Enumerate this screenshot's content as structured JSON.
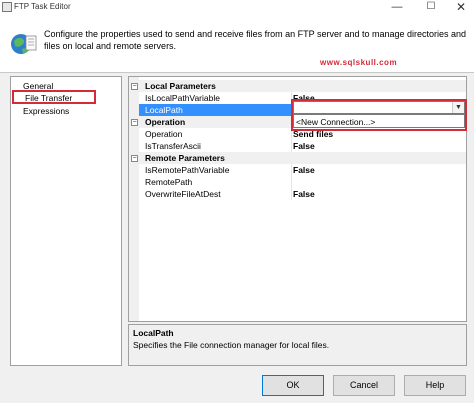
{
  "window": {
    "title": "FTP Task Editor",
    "min_glyph": "—",
    "max_glyph": "☐",
    "close_glyph": "✕"
  },
  "header": {
    "description": "Configure the properties used to send and receive files from an FTP server and to manage directories and files on local and remote servers.",
    "watermark": "www.sqlskull.com"
  },
  "nav": {
    "items": [
      {
        "label": "General",
        "selected": false
      },
      {
        "label": "File Transfer",
        "selected": true
      },
      {
        "label": "Expressions",
        "selected": false
      }
    ]
  },
  "grid": {
    "local_parameters": {
      "label": "Local Parameters",
      "is_local_path_variable": {
        "name": "IsLocalPathVariable",
        "value": "False"
      },
      "local_path": {
        "name": "LocalPath",
        "value": ""
      }
    },
    "operation_cat": {
      "label": "Operation",
      "operation": {
        "name": "Operation",
        "value": "Send files"
      },
      "is_transfer_ascii": {
        "name": "IsTransferAscii",
        "value": "False"
      }
    },
    "remote_parameters": {
      "label": "Remote Parameters",
      "is_remote_path_variable": {
        "name": "IsRemotePathVariable",
        "value": "False"
      },
      "remote_path": {
        "name": "RemotePath",
        "value": ""
      },
      "overwrite_file_at_dest": {
        "name": "OverwriteFileAtDest",
        "value": "False"
      }
    },
    "expander_glyph": "−"
  },
  "dropdown": {
    "option": "<New Connection...>",
    "arrow_glyph": "▼"
  },
  "description": {
    "title": "LocalPath",
    "text": "Specifies the File connection manager for local files."
  },
  "buttons": {
    "ok": "OK",
    "cancel": "Cancel",
    "help": "Help"
  },
  "colors": {
    "highlight_red": "#d42a3a",
    "selection_blue": "#3390ff"
  }
}
